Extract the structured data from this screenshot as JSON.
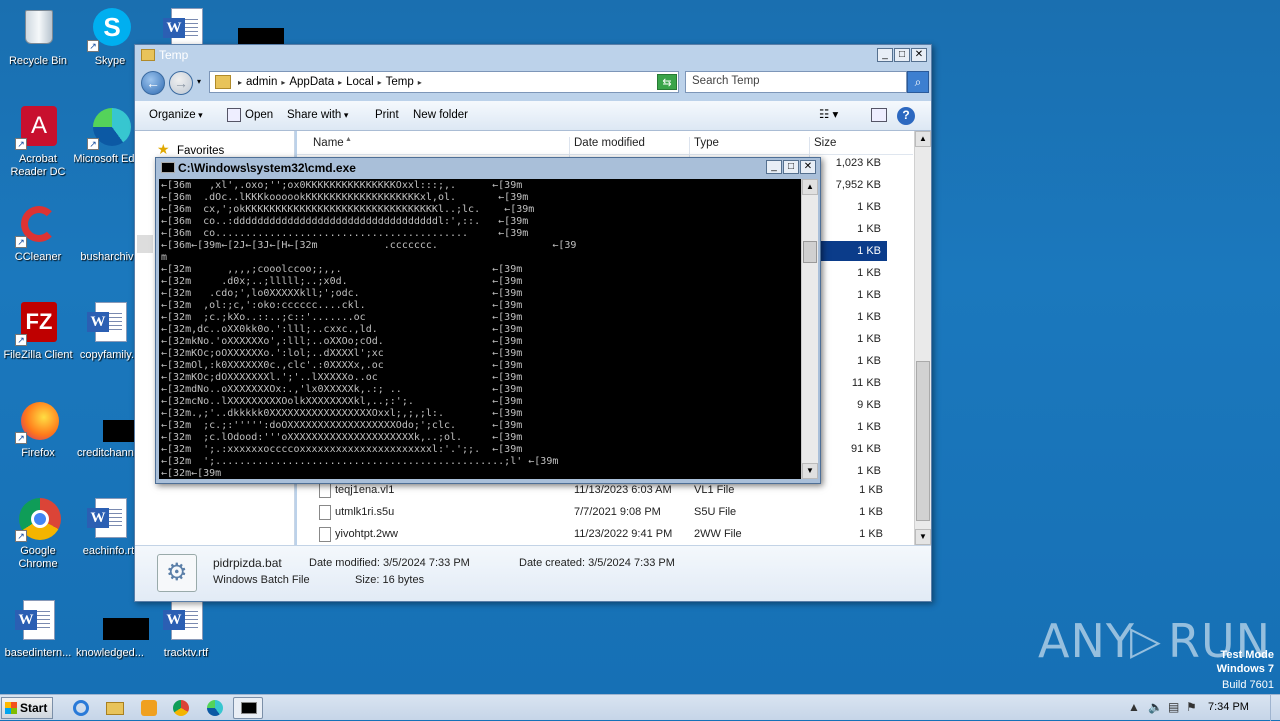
{
  "desktop": {
    "icons": [
      {
        "label": "Recycle Bin"
      },
      {
        "label": "Skype"
      },
      {
        "label": "Acrobat Reader DC"
      },
      {
        "label": "Microsoft Edge"
      },
      {
        "label": "CCleaner"
      },
      {
        "label": "busharchive"
      },
      {
        "label": "FileZilla Client"
      },
      {
        "label": "copyfamily..."
      },
      {
        "label": "Firefox"
      },
      {
        "label": "creditchann..."
      },
      {
        "label": "Google Chrome"
      },
      {
        "label": "eachinfo.rtf"
      },
      {
        "label": "basedintern..."
      },
      {
        "label": "knowledged..."
      },
      {
        "label": "tracktv.rtf"
      }
    ]
  },
  "explorer": {
    "title": "Temp",
    "breadcrumbs": [
      "admin",
      "AppData",
      "Local",
      "Temp"
    ],
    "search_placeholder": "Search Temp",
    "toolbar": {
      "organize": "Organize",
      "open": "Open",
      "share_with": "Share with",
      "print": "Print",
      "new_folder": "New folder"
    },
    "nav": {
      "favorites": "Favorites"
    },
    "columns": {
      "name": "Name",
      "date": "Date modified",
      "type": "Type",
      "size": "Size"
    },
    "sizes_visible": [
      "1,023 KB",
      "7,952 KB",
      "1 KB",
      "1 KB",
      "1 KB",
      "1 KB",
      "1 KB",
      "1 KB",
      "1 KB",
      "1 KB",
      "11 KB",
      "9 KB",
      "1 KB",
      "91 KB",
      "1 KB"
    ],
    "files": [
      {
        "name": "teqj1ena.vl1",
        "date": "11/13/2023 6:03 AM",
        "type": "VL1 File",
        "size": "1 KB"
      },
      {
        "name": "utmlk1ri.s5u",
        "date": "7/7/2021 9:08 PM",
        "type": "S5U File",
        "size": "1 KB"
      },
      {
        "name": "yivohtpt.2ww",
        "date": "11/23/2022 9:41 PM",
        "type": "2WW File",
        "size": "1 KB"
      }
    ],
    "details": {
      "filename": "pidrpizda.bat",
      "filetype": "Windows Batch File",
      "modified": "Date modified: 3/5/2024 7:33 PM",
      "created": "Date created: 3/5/2024 7:33 PM",
      "size": "Size: 16 bytes"
    }
  },
  "cmd": {
    "title": "C:\\Windows\\system32\\cmd.exe",
    "output": "←[36m   ,xl',.oxo;'';ox0KKKKKKKKKKKKKKKOxxl:::;,.      ←[39m\n←[36m  .dOc..lKKKkoooookKKKKKKKKKKKKKKKKKKKxl,ol.       ←[39m\n←[36m  cx,';okKKKKKKKKKKKKKKKKKKKKKKKKKKKKKKKKl..;lc.    ←[39m\n←[36m  co..:ddddddddddddddddddddddddddddddddddl:',::.   ←[39m\n←[36m  co..........................................     ←[39m\n←[36m←[39m←[2J←[3J←[H←[32m           .ccccccc.                   ←[39\nm\n←[32m      ,,,,;cooolccoo;;,,.                         ←[39m\n←[32m     .d0x;..;lllll;..;x0d.                        ←[39m\n←[32m   .cdo;',lo0XXXXXkll;';odc.                      ←[39m\n←[32m  ,ol:;c,':oko:cccccc....ckl.                     ←[39m\n←[32m  ;c.;kXo..::..;c::'.......oc                     ←[39m\n←[32m,dc..oXX0kk0o.':lll;..cxxc.,ld.                   ←[39m\n←[32mkNo.'oXXXXXXo',:lll;..oXXOo;cOd.                  ←[39m\n←[32mKOc;oOXXXXXXo.':lol;..dXXXXl';xc                  ←[39m\n←[32mOl,:k0XXXXXX0c.,clc'.:0XXXXx,.oc                  ←[39m\n←[32mKOc;dOXXXXXXXl.';'..lXXXXXo..oc                   ←[39m\n←[32mdNo..oXXXXXXXOx:.,'lx0XXXXXk,.:; ..               ←[39m\n←[32mcNo..lXXXXXXXXXOolkXXXXXXXXkl,..;:';.             ←[39m\n←[32m.,;'..dkkkkk0XXXXXXXXXXXXXXXXXOxxl;,;,;l:.        ←[39m\n←[32m  ;c.;:''''':doOXXXXXXXXXXXXXXXXXXOdo;';clc.      ←[39m\n←[32m  ;c.lOdood:'''oXXXXXXXXXXXXXXXXXXXXXk,..;ol.     ←[39m\n←[32m  ';.:xxxxxxoccccoxxxxxxxxxxxxxxxxxxxxxxl:'.';;.  ←[39m\n←[32m  ';................................................;l' ←[39m\n←[32m←[39m"
  },
  "watermark": {
    "brand": "ANY",
    "brand2": "RUN",
    "mode": "Test Mode",
    "os": "Windows 7",
    "build": "Build 7601"
  },
  "taskbar": {
    "start": "Start",
    "clock": "7:34 PM"
  }
}
